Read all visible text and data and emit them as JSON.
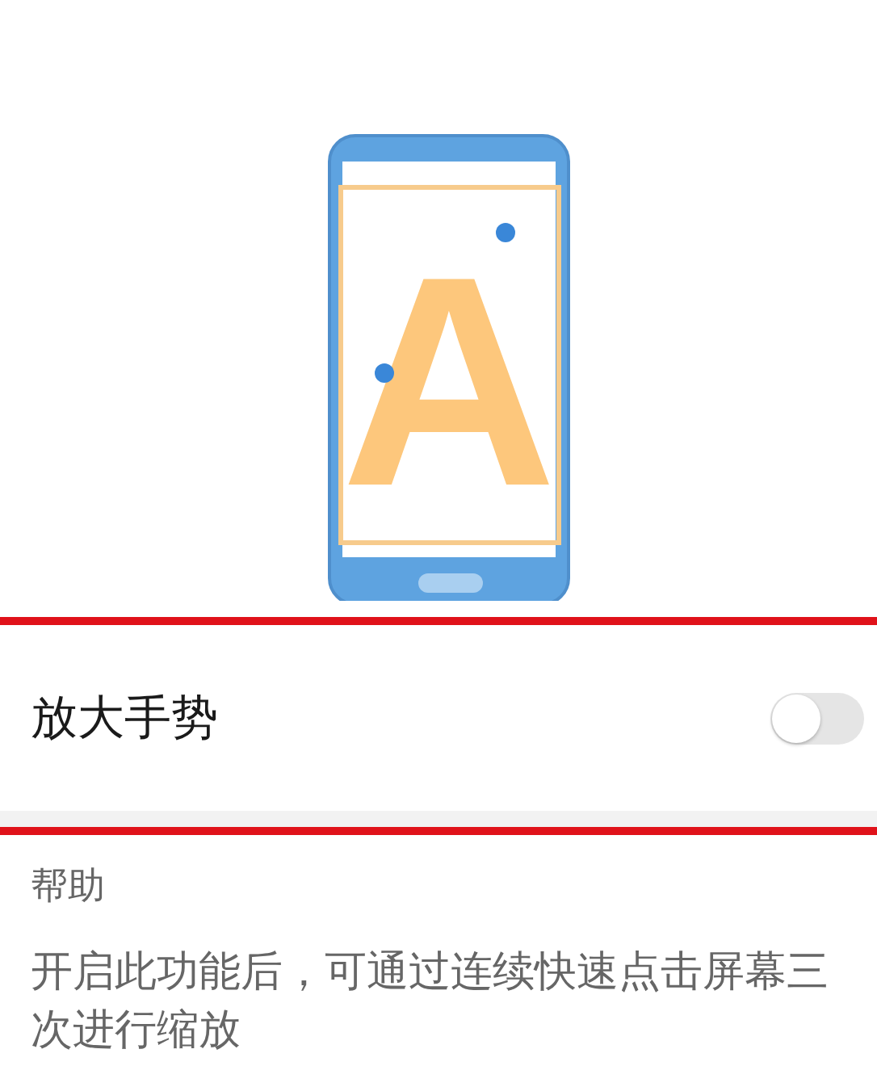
{
  "illustration": {
    "letter": "A"
  },
  "setting": {
    "label": "放大手势",
    "on": false
  },
  "help": {
    "title": "帮助",
    "text": "开启此功能后，可通过连续快速点击屏幕三次进行缩放"
  }
}
